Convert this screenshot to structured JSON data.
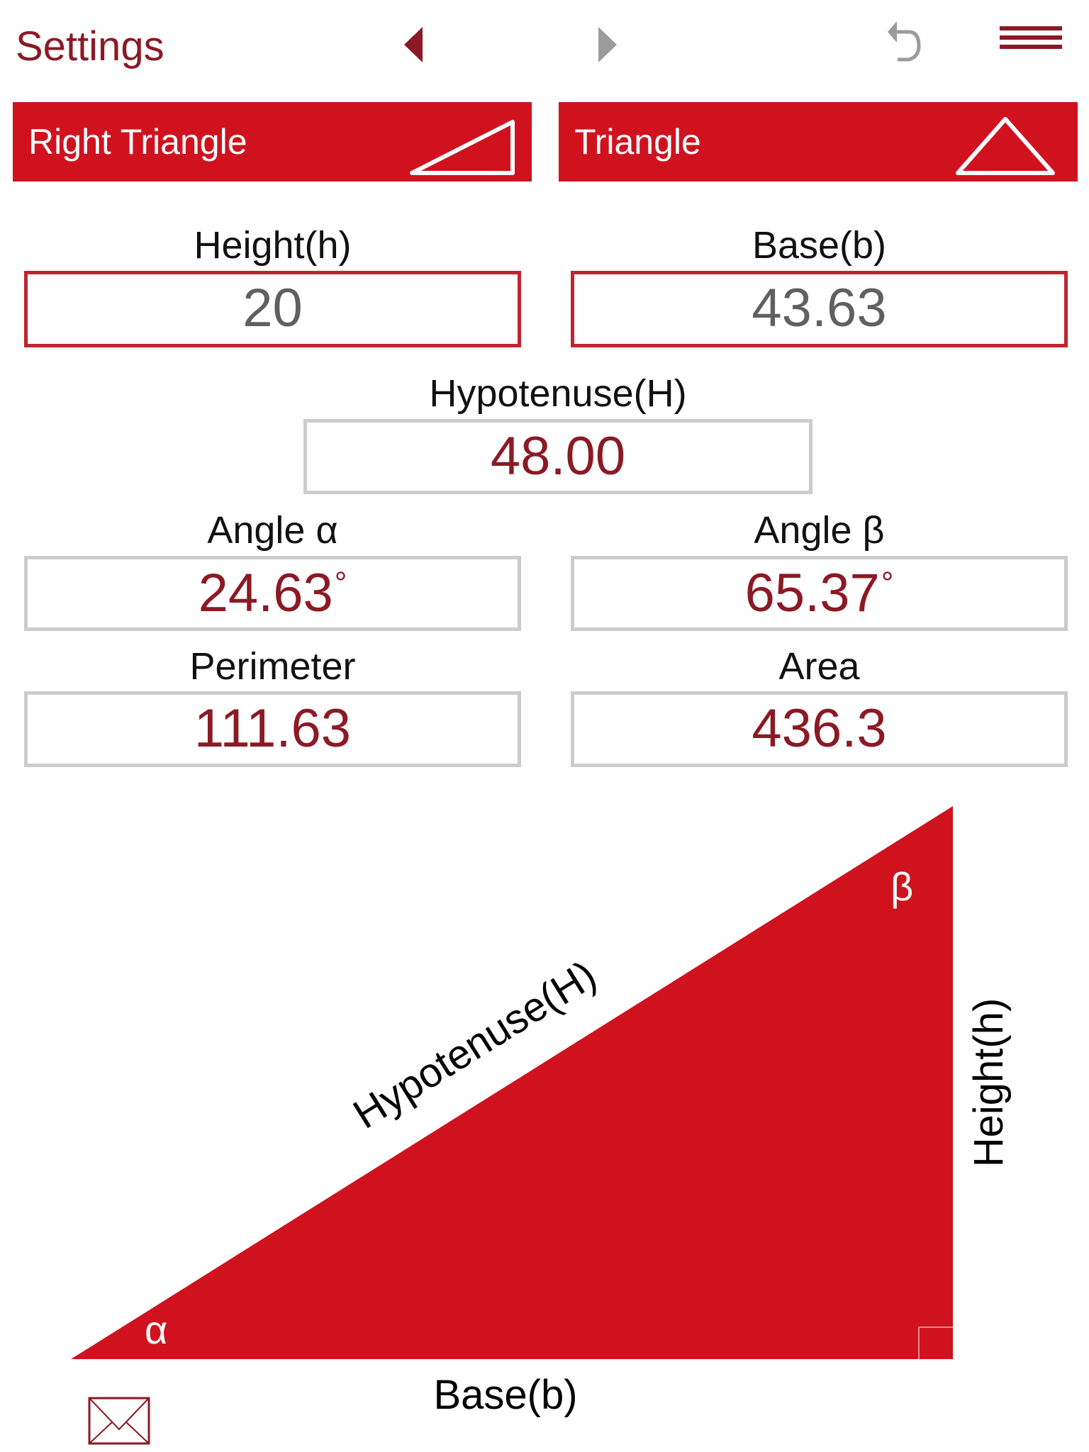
{
  "header": {
    "settings_label": "Settings",
    "icons": {
      "prev": "chevron-left-icon",
      "next": "chevron-right-icon",
      "undo": "undo-icon",
      "menu": "hamburger-menu-icon"
    }
  },
  "tabs": [
    {
      "label": "Right Triangle",
      "icon": "right-triangle-icon",
      "active": true
    },
    {
      "label": "Triangle",
      "icon": "triangle-icon",
      "active": false
    }
  ],
  "fields": {
    "height": {
      "label": "Height(h)",
      "value": "20"
    },
    "base": {
      "label": "Base(b)",
      "value": "43.63"
    },
    "hypotenuse": {
      "label": "Hypotenuse(H)",
      "value": "48.00"
    },
    "angle_alpha": {
      "label": "Angle α",
      "value": "24.63",
      "unit": "°"
    },
    "angle_beta": {
      "label": "Angle β",
      "value": "65.37",
      "unit": "°"
    },
    "perimeter": {
      "label": "Perimeter",
      "value": "111.63"
    },
    "area": {
      "label": "Area",
      "value": "436.3"
    }
  },
  "diagram": {
    "hypotenuse_label": "Hypotenuse(H)",
    "height_label": "Height(h)",
    "base_label": "Base(b)",
    "alpha_symbol": "α",
    "beta_symbol": "β"
  },
  "footer": {
    "mail_icon": "mail-icon"
  },
  "colors": {
    "accent": "#d0121f",
    "dark_accent": "#8b1a24",
    "input_border": "#be2530",
    "output_border": "#cccccc",
    "gray_icon": "#9b9b9b"
  }
}
